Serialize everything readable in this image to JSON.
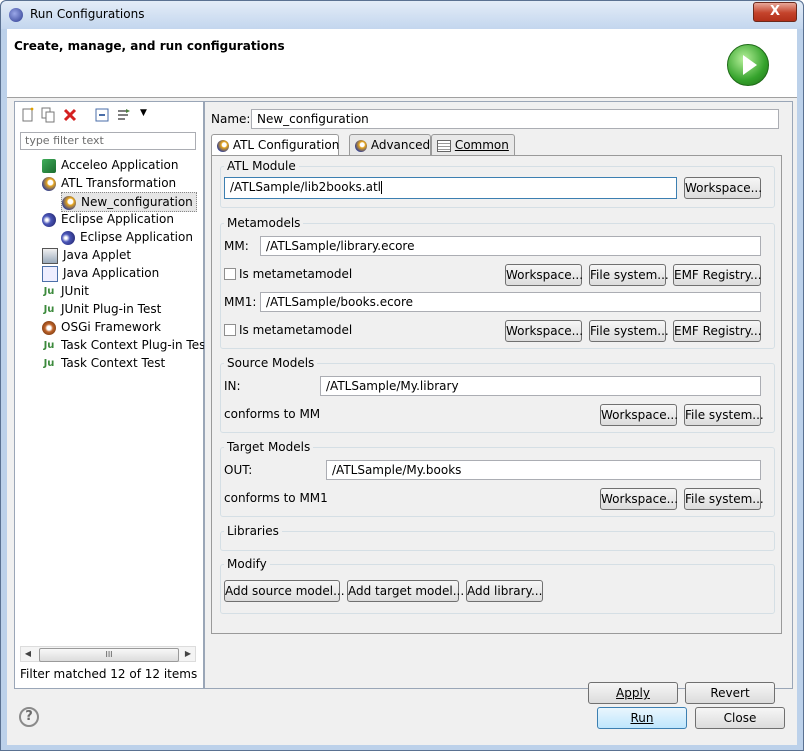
{
  "window": {
    "title": "Run Configurations",
    "close_label": "X"
  },
  "banner": {
    "title": "Create, manage, and run configurations"
  },
  "left": {
    "filter_placeholder": "type filter text",
    "tree": [
      {
        "label": "Acceleo Application",
        "icon": "acceleo-icon",
        "level": 1
      },
      {
        "label": "ATL Transformation",
        "icon": "atl-icon",
        "level": 1
      },
      {
        "label": "New_configuration",
        "icon": "atl-icon",
        "level": 2,
        "selected": true
      },
      {
        "label": "Eclipse Application",
        "icon": "eclipse-icon",
        "level": 1
      },
      {
        "label": "Eclipse Application",
        "icon": "eclipse-icon",
        "level": 2
      },
      {
        "label": "Java Applet",
        "icon": "applet-icon",
        "level": 1
      },
      {
        "label": "Java Application",
        "icon": "java-app-icon",
        "level": 1
      },
      {
        "label": "JUnit",
        "icon": "junit-icon",
        "level": 1
      },
      {
        "label": "JUnit Plug-in Test",
        "icon": "junit-plugin-icon",
        "level": 1
      },
      {
        "label": "OSGi Framework",
        "icon": "osgi-icon",
        "level": 1
      },
      {
        "label": "Task Context Plug-in Test",
        "icon": "task-plugin-icon",
        "level": 1
      },
      {
        "label": "Task Context Test",
        "icon": "task-test-icon",
        "level": 1
      }
    ],
    "scroll_thumb": "III",
    "status": "Filter matched 12 of 12 items"
  },
  "right": {
    "name_label": "Name:",
    "name_value": "New_configuration",
    "tabs": [
      "ATL Configuration",
      "Advanced",
      "Common"
    ],
    "atl_module": {
      "title": "ATL Module",
      "value": "/ATLSample/lib2books.atl",
      "workspace": "Workspace..."
    },
    "metamodels": {
      "title": "Metamodels",
      "items": [
        {
          "label": "MM:",
          "value": "/ATLSample/library.ecore",
          "checkbox": "Is metametamodel"
        },
        {
          "label": "MM1:",
          "value": "/ATLSample/books.ecore",
          "checkbox": "Is metametamodel"
        }
      ],
      "btn_workspace": "Workspace...",
      "btn_filesystem": "File system...",
      "btn_emf": "EMF Registry..."
    },
    "source_models": {
      "title": "Source Models",
      "label": "IN:",
      "value": "/ATLSample/My.library",
      "conforms": "conforms to MM",
      "workspace": "Workspace...",
      "filesystem": "File system..."
    },
    "target_models": {
      "title": "Target Models",
      "label": "OUT:",
      "value": "/ATLSample/My.books",
      "conforms": "conforms to MM1",
      "workspace": "Workspace...",
      "filesystem": "File system..."
    },
    "libraries": {
      "title": "Libraries"
    },
    "modify": {
      "title": "Modify",
      "add_source": "Add source model...",
      "add_target": "Add target model...",
      "add_library": "Add library..."
    },
    "apply": "Apply",
    "revert": "Revert"
  },
  "footer": {
    "help": "?",
    "run": "Run",
    "close": "Close"
  }
}
